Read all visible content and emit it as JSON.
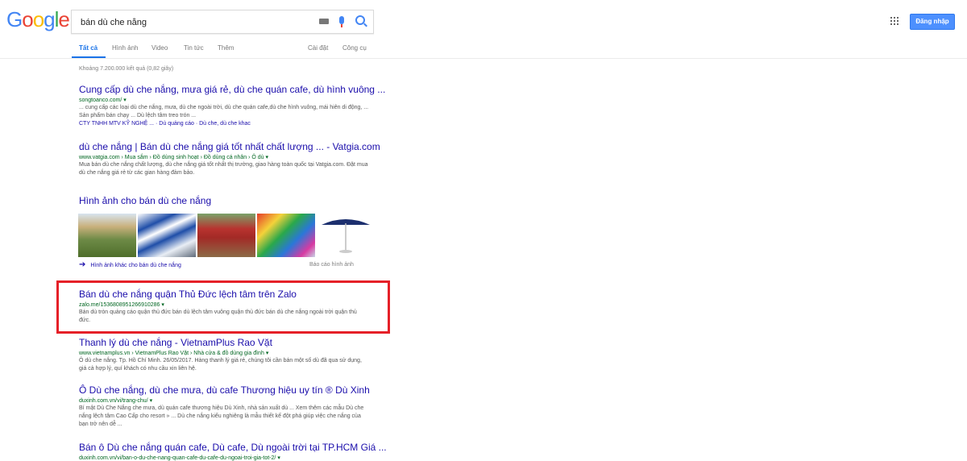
{
  "header": {
    "logo": "Google",
    "search_value": "bán dù che nắng",
    "signin_label": "Đăng nhập",
    "tabs": [
      "Tất cả",
      "Hình ảnh",
      "Video",
      "Tin tức",
      "Thêm"
    ],
    "right_tabs": [
      "Cài đặt",
      "Công cụ"
    ]
  },
  "stats": "Khoảng 7.200.000 kết quả (0,82 giây)",
  "results": [
    {
      "title": "Cung cấp dù che nắng, mưa giá rẻ, dù che quán cafe, dù hình vuông ...",
      "url": "songtoanco.com/",
      "snippet": "... cung cấp các loại dù che nắng, mưa, dù che ngoài trời, dù che quán cafe,dù che hình vuông, mái hiên di động, ... Sản phẩm bán chạy ... Dù lệch tâm treo trón ...",
      "links": "CTY TNHH MTV KỸ NGHỆ ... · Dù quảng cáo · Dù che, dù che khac"
    },
    {
      "title": "dù che nắng | Bán dù che nắng giá tốt nhất chất lượng ... - Vatgia.com",
      "url": "www.vatgia.com › Mua sắm › Đồ dùng sinh hoạt › Đồ dùng cá nhân › Ô dù",
      "snippet": "Mua bán dù che nắng chất lượng, dù che nắng giá tốt nhất thị trường, giao hàng toàn quốc tại Vatgia.com. Đặt mua dù che nắng giá rẻ từ các gian hàng đảm bảo."
    },
    {
      "title": "Bán dù che nắng quận Thủ Đức lệch tâm trên Zalo",
      "url": "zalo.me/1536808951266910286",
      "snippet": "Bán dù tròn quảng cáo quận thủ đức bán dù lệch tâm vuông quận thủ đức bán dù che nắng ngoài trời quận thủ đức."
    },
    {
      "title": "Thanh lý dù che nắng - VietnamPlus Rao Vặt",
      "url": "www.vietnamplus.vn › VietnamPlus Rao Vặt › Nhà cửa & đồ dùng gia đình",
      "snippet": "Ô dù che nắng. Tp. Hồ Chí Minh. 26/05/2017. Hàng thanh lý giá rẻ, chúng tôi cần bán một số dù đã qua sử dụng, giá cả hợp lý, quí khách có nhu cầu xin liên hệ."
    },
    {
      "title": "Ô Dù che nắng, dù che mưa, dù cafe Thương hiệu uy tín ® Dù Xinh",
      "url": "duxinh.com.vn/vi/trang-chu/",
      "snippet": "Bí mật Dù Che Nắng che mưa, dù quán cafe thương hiệu Dù Xinh, nhà sản xuất dù ... Xem thêm các mẫu Dù che nắng lệch tâm Cao Cấp cho resort » ... Dù che nắng kiểu nghiêng là mẫu thiết kế đột phá giúp việc che nắng của bạn trở nên dễ ..."
    },
    {
      "title": "Bán ô Dù che nắng quán cafe, Dù cafe, Dù ngoài trời tại TP.HCM Giá ...",
      "url": "duxinh.com.vn/vi/ban-o-du-che-nang-quan-cafe-du-cafe-du-ngoai-troi-gia-tot-2/",
      "snippet": ""
    }
  ],
  "images": {
    "heading": "Hình ảnh cho bán dù che nắng",
    "more": "Hình ảnh khác cho bán dù che nắng",
    "report": "Báo cáo hình ảnh"
  }
}
